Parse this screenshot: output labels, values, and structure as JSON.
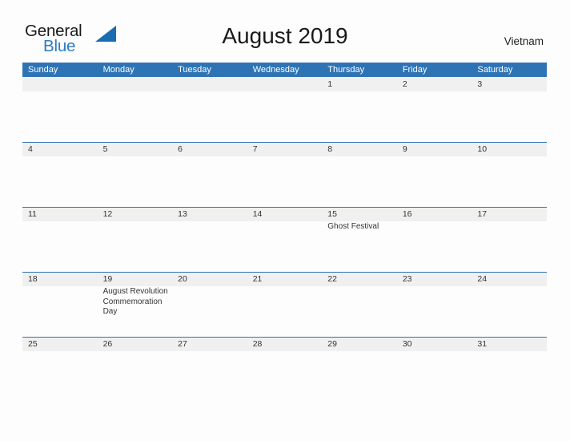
{
  "brand": {
    "name_top": "General",
    "name_bottom": "Blue",
    "triangle_icon": "blue-triangle-icon",
    "accent_color": "#2a7bc8"
  },
  "header": {
    "title": "August 2019",
    "country": "Vietnam"
  },
  "theme": {
    "header_blue": "#2e74b5",
    "date_strip_gray": "#f0f0f0",
    "rule_blue": "#2e74b5",
    "text_dark": "#333333",
    "page_background": "#fdfdfd"
  },
  "calendar": {
    "month": "August",
    "year": "2019",
    "day_headers": [
      "Sunday",
      "Monday",
      "Tuesday",
      "Wednesday",
      "Thursday",
      "Friday",
      "Saturday"
    ],
    "weeks": [
      {
        "days": [
          {
            "num": "",
            "events": []
          },
          {
            "num": "",
            "events": []
          },
          {
            "num": "",
            "events": []
          },
          {
            "num": "",
            "events": []
          },
          {
            "num": "1",
            "events": []
          },
          {
            "num": "2",
            "events": []
          },
          {
            "num": "3",
            "events": []
          }
        ]
      },
      {
        "days": [
          {
            "num": "4",
            "events": []
          },
          {
            "num": "5",
            "events": []
          },
          {
            "num": "6",
            "events": []
          },
          {
            "num": "7",
            "events": []
          },
          {
            "num": "8",
            "events": []
          },
          {
            "num": "9",
            "events": []
          },
          {
            "num": "10",
            "events": []
          }
        ]
      },
      {
        "days": [
          {
            "num": "11",
            "events": []
          },
          {
            "num": "12",
            "events": []
          },
          {
            "num": "13",
            "events": []
          },
          {
            "num": "14",
            "events": []
          },
          {
            "num": "15",
            "events": [
              "Ghost Festival"
            ]
          },
          {
            "num": "16",
            "events": []
          },
          {
            "num": "17",
            "events": []
          }
        ]
      },
      {
        "days": [
          {
            "num": "18",
            "events": []
          },
          {
            "num": "19",
            "events": [
              "August Revolution Commemoration Day"
            ]
          },
          {
            "num": "20",
            "events": []
          },
          {
            "num": "21",
            "events": []
          },
          {
            "num": "22",
            "events": []
          },
          {
            "num": "23",
            "events": []
          },
          {
            "num": "24",
            "events": []
          }
        ]
      },
      {
        "days": [
          {
            "num": "25",
            "events": []
          },
          {
            "num": "26",
            "events": []
          },
          {
            "num": "27",
            "events": []
          },
          {
            "num": "28",
            "events": []
          },
          {
            "num": "29",
            "events": []
          },
          {
            "num": "30",
            "events": []
          },
          {
            "num": "31",
            "events": []
          }
        ]
      }
    ]
  }
}
